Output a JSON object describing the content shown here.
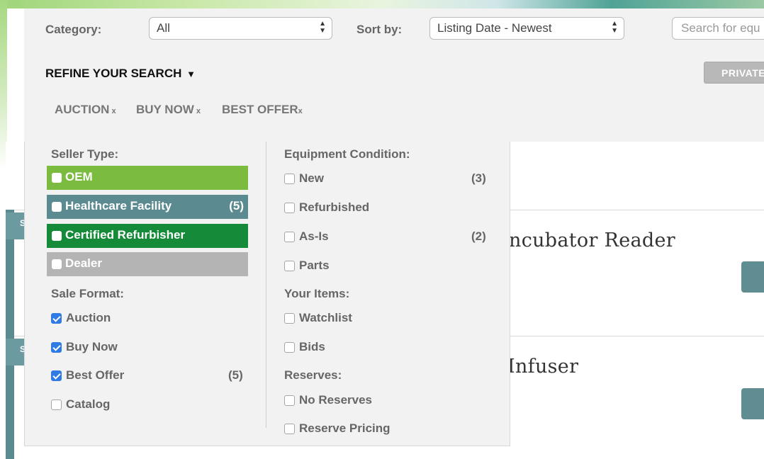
{
  "filters": {
    "category_label": "Category:",
    "category_value": "All",
    "sort_label": "Sort by:",
    "sort_value": "Listing Date - Newest",
    "search_placeholder": "Search for equ",
    "refine_label": "REFINE YOUR SEARCH",
    "refine_arrow": "▼",
    "private_button": "PRIVATE"
  },
  "active_chips": [
    {
      "label": "AUCTION",
      "remove": "x"
    },
    {
      "label": "BUY NOW",
      "remove": "x"
    },
    {
      "label": "BEST OFFER",
      "remove": "x"
    }
  ],
  "seller_type": {
    "title": "Seller Type:",
    "items": [
      {
        "label": "OEM",
        "count": "",
        "color": "#7bbb3f"
      },
      {
        "label": "Healthcare Facility",
        "count": "(5)",
        "color": "#5b8a90"
      },
      {
        "label": "Certified Refurbisher",
        "count": "",
        "color": "#158b3a"
      },
      {
        "label": "Dealer",
        "count": "",
        "color": "#b4b4b4"
      }
    ]
  },
  "sale_format": {
    "title": "Sale Format:",
    "items": [
      {
        "label": "Auction",
        "checked": true,
        "count": ""
      },
      {
        "label": "Buy Now",
        "checked": true,
        "count": ""
      },
      {
        "label": "Best Offer",
        "checked": true,
        "count": "(5)"
      },
      {
        "label": "Catalog",
        "checked": false,
        "count": ""
      }
    ]
  },
  "equipment_condition": {
    "title": "Equipment Condition:",
    "items": [
      {
        "label": "New",
        "count": "(3)"
      },
      {
        "label": "Refurbished",
        "count": ""
      },
      {
        "label": "As-Is",
        "count": "(2)"
      },
      {
        "label": "Parts",
        "count": ""
      }
    ]
  },
  "your_items": {
    "title": "Your Items:",
    "items": [
      {
        "label": "Watchlist"
      },
      {
        "label": "Bids"
      }
    ]
  },
  "reserves": {
    "title": "Reserves:",
    "items": [
      {
        "label": "No Reserves"
      },
      {
        "label": "Reserve Pricing"
      }
    ]
  },
  "listings": [
    {
      "title_fragment": "ncubator Reader",
      "tag": "S"
    },
    {
      "title_fragment": "Infuser",
      "tag": "S"
    }
  ]
}
